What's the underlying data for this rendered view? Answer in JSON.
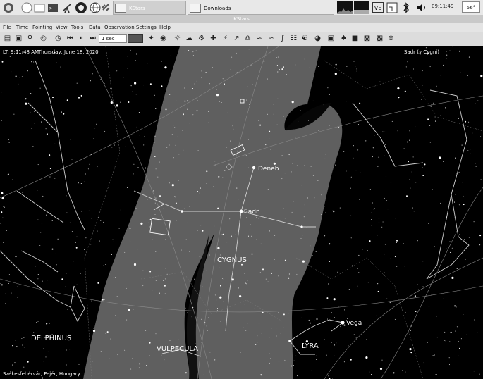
{
  "taskbar": {
    "task_kstars": "KStars",
    "task_downloads": "Downloads",
    "tray_ve": "VE",
    "clock": "09:11:49",
    "temperature": "56°"
  },
  "window": {
    "title": "KStars"
  },
  "menu": {
    "file": "File",
    "time": "Time",
    "pointing": "Pointing",
    "view": "View",
    "tools": "Tools",
    "data": "Data",
    "observation": "Observation",
    "settings": "Settings",
    "help": "Help"
  },
  "toolbar": {
    "time_step": "1 sec"
  },
  "overlay": {
    "local_time": "LT: 9:11:48 AM",
    "date": "Thursday, June 18, 2020",
    "focus_object": "Sadr (γ Cygni)",
    "location": "Székesfehérvár, Fejér, Hungary"
  },
  "stars": {
    "deneb": "Deneb",
    "sadr": "Sadr",
    "vega": "Vega"
  },
  "constellations": {
    "cygnus": "CYGNUS",
    "delphinus": "DELPHINUS",
    "vulpecula": "VULPECULA",
    "lyra": "LYRA"
  }
}
